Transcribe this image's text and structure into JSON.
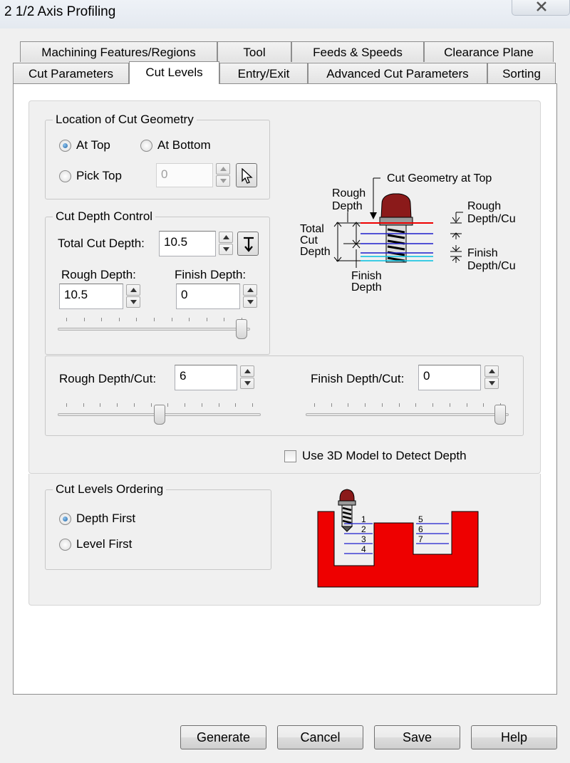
{
  "window": {
    "title": "2 1/2 Axis Profiling"
  },
  "tabs": {
    "row1": [
      "Machining Features/Regions",
      "Tool",
      "Feeds & Speeds",
      "Clearance Plane"
    ],
    "row2": [
      "Cut Parameters",
      "Cut Levels",
      "Entry/Exit",
      "Advanced Cut Parameters",
      "Sorting"
    ],
    "active": "Cut Levels"
  },
  "location": {
    "title": "Location of Cut Geometry",
    "at_top": "At Top",
    "at_bottom": "At Bottom",
    "pick_top": "Pick Top",
    "pick_value": "0",
    "selected": "At Top"
  },
  "depth": {
    "title": "Cut Depth Control",
    "total_label": "Total Cut Depth:",
    "total_value": "10.5",
    "rough_label": "Rough Depth:",
    "rough_value": "10.5",
    "finish_label": "Finish Depth:",
    "finish_value": "0",
    "split_slider_fraction": 1.0
  },
  "per_cut": {
    "rough_label": "Rough Depth/Cut:",
    "rough_value": "6",
    "rough_slider_fraction": 0.5,
    "finish_label": "Finish Depth/Cut:",
    "finish_value": "0",
    "finish_slider_fraction": 1.0
  },
  "use_3d": {
    "label": "Use 3D Model to Detect Depth",
    "checked": false
  },
  "ordering": {
    "title": "Cut Levels Ordering",
    "depth_first": "Depth First",
    "level_first": "Level First",
    "selected": "Depth First"
  },
  "diagram_depth": {
    "cut_geometry_top": "Cut Geometry at Top",
    "rough_depth_1": "Rough",
    "rough_depth_2": "Depth",
    "total_1": "Total",
    "total_2": "Cut",
    "total_3": "Depth",
    "finish_1": "Finish",
    "finish_2": "Depth",
    "rough_cut_1": "Rough",
    "rough_cut_2": "Depth/Cut",
    "finish_cut_1": "Finish",
    "finish_cut_2": "Depth/Cut"
  },
  "diagram_order": {
    "levels": [
      "1",
      "2",
      "3",
      "4",
      "5",
      "6",
      "7"
    ]
  },
  "buttons": {
    "generate": "Generate",
    "cancel": "Cancel",
    "save": "Save",
    "help": "Help"
  },
  "colors": {
    "part_red": "#ee0000",
    "tool_maroon": "#8b1a1a",
    "level_blue": "#1d1dcc",
    "finish_cyan": "#00c0e0"
  }
}
